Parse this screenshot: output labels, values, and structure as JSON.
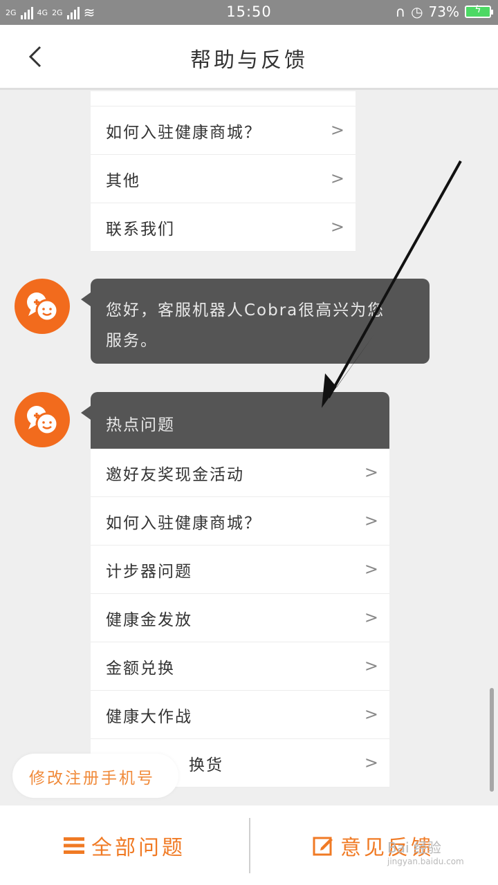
{
  "status_bar": {
    "signal_1": "2G",
    "signal_2": "4G",
    "signal_3": "2G",
    "time": "15:50",
    "battery": "73%"
  },
  "header": {
    "back_icon": "chevron-left-icon",
    "title": "帮助与反馈"
  },
  "top_list": {
    "items": [
      {
        "label": "如何入驻健康商城？"
      },
      {
        "label": "其他"
      },
      {
        "label": "联系我们"
      }
    ]
  },
  "greeting": {
    "text_line1": "您好，客服机器人Cobra很高兴为您",
    "text_line2": "服务。"
  },
  "hot_topics": {
    "title": "热点问题",
    "items": [
      {
        "label": "邀好友奖现金活动"
      },
      {
        "label": "如何入驻健康商城？"
      },
      {
        "label": "计步器问题"
      },
      {
        "label": "健康金发放"
      },
      {
        "label": "金额兑换"
      },
      {
        "label": "健康大作战"
      },
      {
        "label": "换货"
      }
    ]
  },
  "floating_tip": "修改注册手机号",
  "bottom_bar": {
    "all_questions": "全部问题",
    "feedback": "意见反馈"
  },
  "watermark": {
    "brand": "Bai 经验",
    "url": "jingyan.baidu.com"
  },
  "colors": {
    "accent": "#f07a24",
    "avatar": "#f26b1d",
    "bubble": "#555555"
  }
}
